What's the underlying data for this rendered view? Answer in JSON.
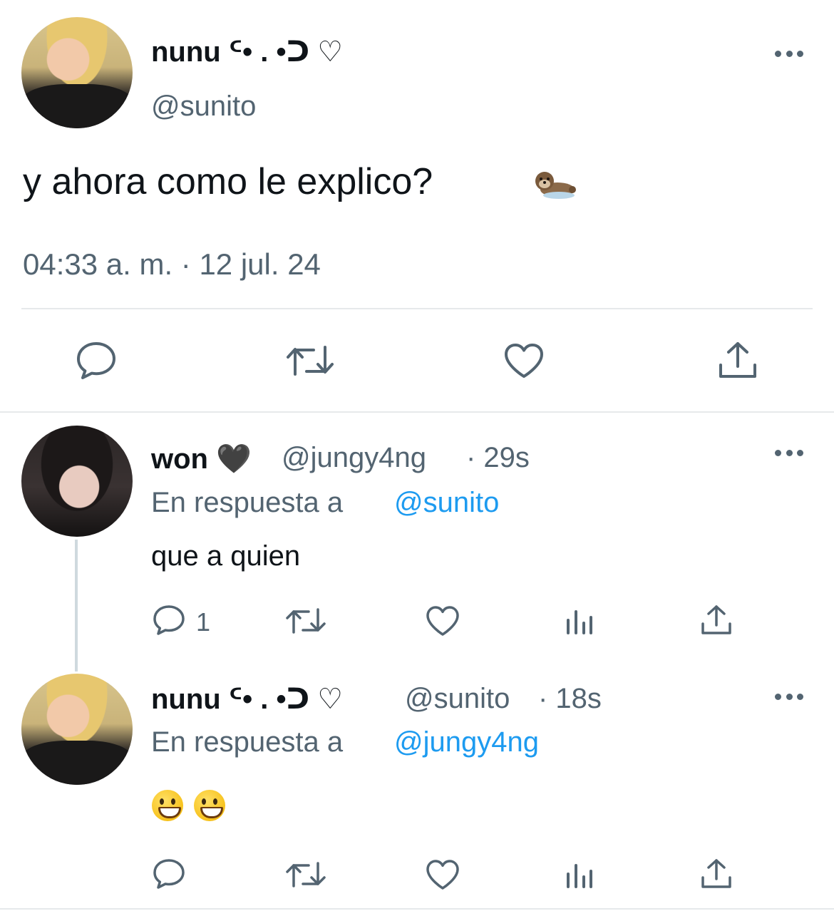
{
  "main_tweet": {
    "author_name": "nunu ᑦ• . •ᑐ ♡",
    "author_handle": "@sunito",
    "text": "y ahora como le explico?",
    "text_emoji": "sea-otter-emoji",
    "timestamp": "04:33 a. m. · 12 jul. 24"
  },
  "replies": [
    {
      "author_name": "won 🖤",
      "author_handle": "@jungy4ng",
      "age": "· 29s",
      "reply_prefix": "En respuesta a",
      "reply_to": "@sunito",
      "text": "que a quien",
      "reply_count": "1"
    },
    {
      "author_name": "nunu ᑦ• . •ᑐ ♡",
      "author_handle": "@sunito",
      "age": "· 18s",
      "reply_prefix": "En respuesta a",
      "reply_to": "@jungy4ng",
      "emojis": [
        "grinning-face-emoji",
        "grinning-face-emoji"
      ]
    }
  ],
  "colors": {
    "text": "#0f1419",
    "muted": "#536471",
    "link": "#1d9bf0",
    "divider": "#e6e9eb",
    "thread_line": "#cfd9de"
  },
  "icons": [
    "comment-icon",
    "retweet-icon",
    "like-icon",
    "views-icon",
    "share-icon",
    "more-icon"
  ]
}
